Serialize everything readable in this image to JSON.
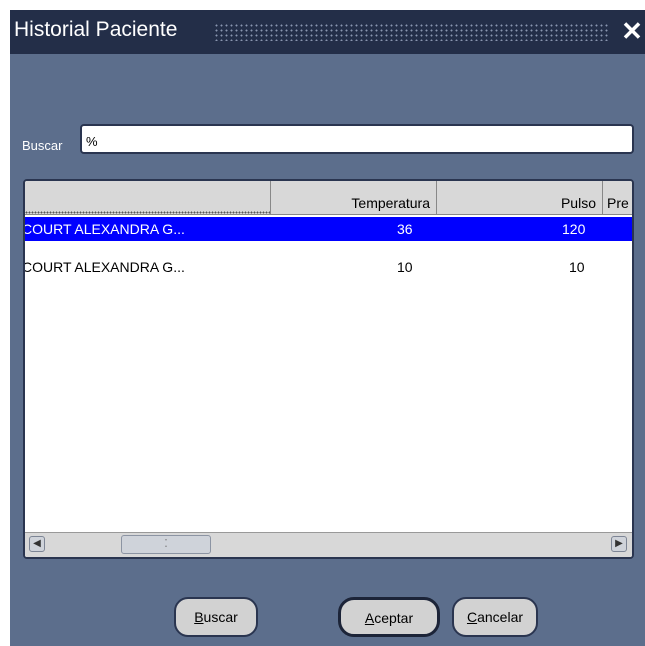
{
  "window": {
    "title": "Historial Paciente",
    "close_glyph": "✕"
  },
  "search": {
    "label": "Buscar",
    "value": "%"
  },
  "table": {
    "columns": [
      "",
      "Temperatura",
      "Pulso",
      "Pre"
    ],
    "rows": [
      {
        "name": "COURT ALEXANDRA G...",
        "temperatura": "36",
        "pulso": "120",
        "selected": true
      },
      {
        "name": "COURT ALEXANDRA G...",
        "temperatura": "10",
        "pulso": "10",
        "selected": false
      }
    ],
    "scroll": {
      "left_arrow": "◀",
      "right_arrow": "▶",
      "thumb_grip": "⁚"
    }
  },
  "buttons": {
    "buscar": {
      "mnemonic": "B",
      "rest": "uscar"
    },
    "aceptar": {
      "mnemonic": "A",
      "rest": "ceptar"
    },
    "cancelar": {
      "mnemonic": "C",
      "rest": "ancelar"
    }
  },
  "colors": {
    "window_bg": "#5c6e8c",
    "titlebar_bg": "#232e48",
    "selection": "#0000ff"
  }
}
